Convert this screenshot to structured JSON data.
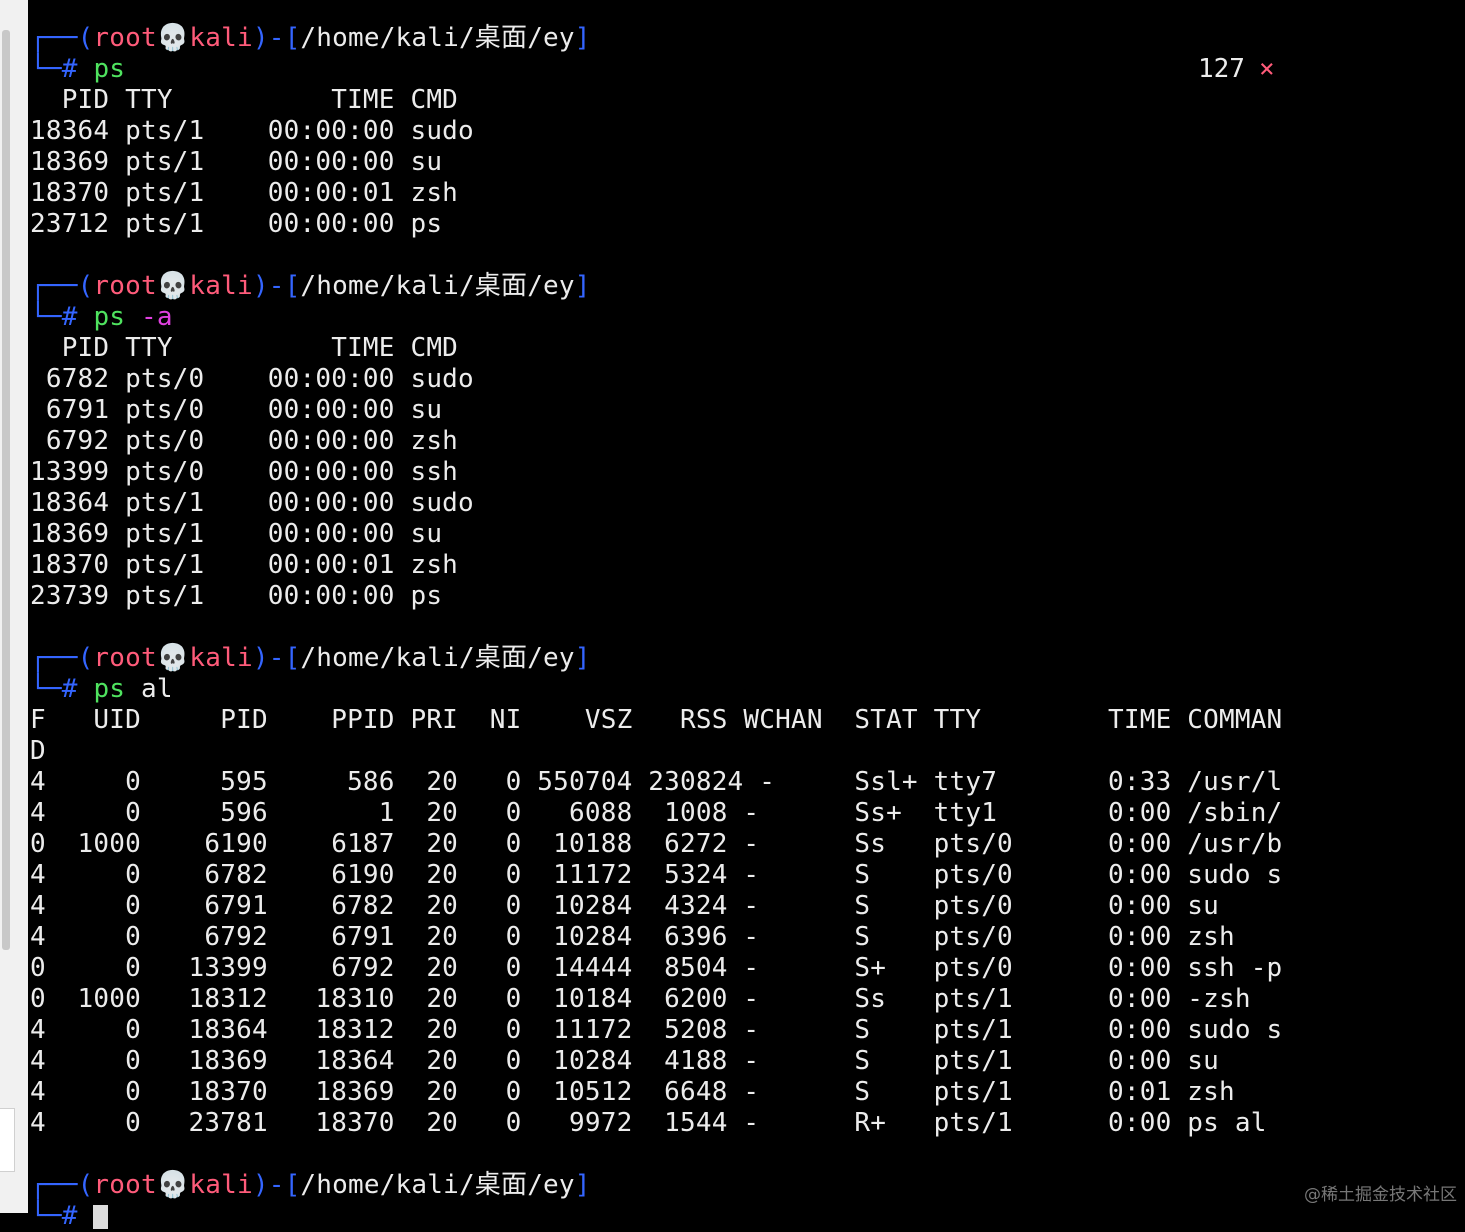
{
  "prompt": {
    "corner_top": "┌──",
    "corner_bottom": "└─",
    "open_paren": "(",
    "user": "root",
    "skull": "💀",
    "host": "kali",
    "close_paren": ")",
    "dash": "-",
    "open_bracket": "[",
    "path": "/home/kali/桌面/ey",
    "close_bracket": "]",
    "hash": "#"
  },
  "status": {
    "exit_code": "127",
    "error_mark": "×"
  },
  "blocks": [
    {
      "cmd": "ps",
      "arg": "",
      "arg2": "",
      "output": [
        "  PID TTY          TIME CMD",
        "18364 pts/1    00:00:00 sudo",
        "18369 pts/1    00:00:00 su",
        "18370 pts/1    00:00:01 zsh",
        "23712 pts/1    00:00:00 ps"
      ]
    },
    {
      "cmd": "ps",
      "arg": "-a",
      "arg2": "",
      "output": [
        "  PID TTY          TIME CMD",
        " 6782 pts/0    00:00:00 sudo",
        " 6791 pts/0    00:00:00 su",
        " 6792 pts/0    00:00:00 zsh",
        "13399 pts/0    00:00:00 ssh",
        "18364 pts/1    00:00:00 sudo",
        "18369 pts/1    00:00:00 su",
        "18370 pts/1    00:00:01 zsh",
        "23739 pts/1    00:00:00 ps"
      ]
    },
    {
      "cmd": "ps",
      "arg": "",
      "arg2": "al",
      "output": [
        "F   UID     PID    PPID PRI  NI    VSZ   RSS WCHAN  STAT TTY        TIME COMMAN",
        "D",
        "4     0     595     586  20   0 550704 230824 -     Ssl+ tty7       0:33 /usr/l",
        "4     0     596       1  20   0   6088  1008 -      Ss+  tty1       0:00 /sbin/",
        "0  1000    6190    6187  20   0  10188  6272 -      Ss   pts/0      0:00 /usr/b",
        "4     0    6782    6190  20   0  11172  5324 -      S    pts/0      0:00 sudo s",
        "4     0    6791    6782  20   0  10284  4324 -      S    pts/0      0:00 su",
        "4     0    6792    6791  20   0  10284  6396 -      S    pts/0      0:00 zsh",
        "0     0   13399    6792  20   0  14444  8504 -      S+   pts/0      0:00 ssh -p",
        "0  1000   18312   18310  20   0  10184  6200 -      Ss   pts/1      0:00 -zsh",
        "4     0   18364   18312  20   0  11172  5208 -      S    pts/1      0:00 sudo s",
        "4     0   18369   18364  20   0  10284  4188 -      S    pts/1      0:00 su",
        "4     0   18370   18369  20   0  10512  6648 -      S    pts/1      0:01 zsh",
        "4     0   23781   18370  20   0   9972  1544 -      R+   pts/1      0:00 ps al"
      ]
    }
  ],
  "watermark": "@稀土掘金技术社区"
}
